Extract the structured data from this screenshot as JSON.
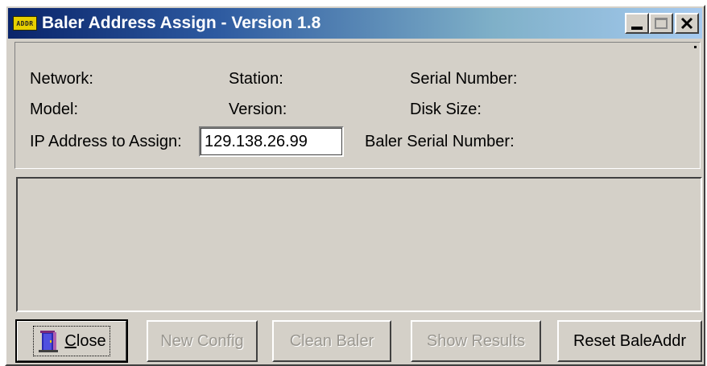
{
  "window": {
    "title": "Baler Address Assign - Version 1.8",
    "icon_text": "ADDR"
  },
  "fields": {
    "network_label": "Network:",
    "station_label": "Station:",
    "serial_number_label": "Serial Number:",
    "model_label": "Model:",
    "version_label": "Version:",
    "disk_size_label": "Disk Size:",
    "ip_label": "IP Address to Assign:",
    "ip_value": "129.138.26.99",
    "baler_serial_label": "Baler Serial Number:"
  },
  "buttons": {
    "close_first": "C",
    "close_rest": "lose",
    "new_config": "New Config",
    "clean_baler": "Clean Baler",
    "show_results": "Show Results",
    "reset_baleaddr": "Reset BaleAddr"
  },
  "colors": {
    "face": "#d4d0c8",
    "title_start": "#0a246a",
    "title_end": "#a6caf0",
    "disabled_text": "#9a9790"
  }
}
